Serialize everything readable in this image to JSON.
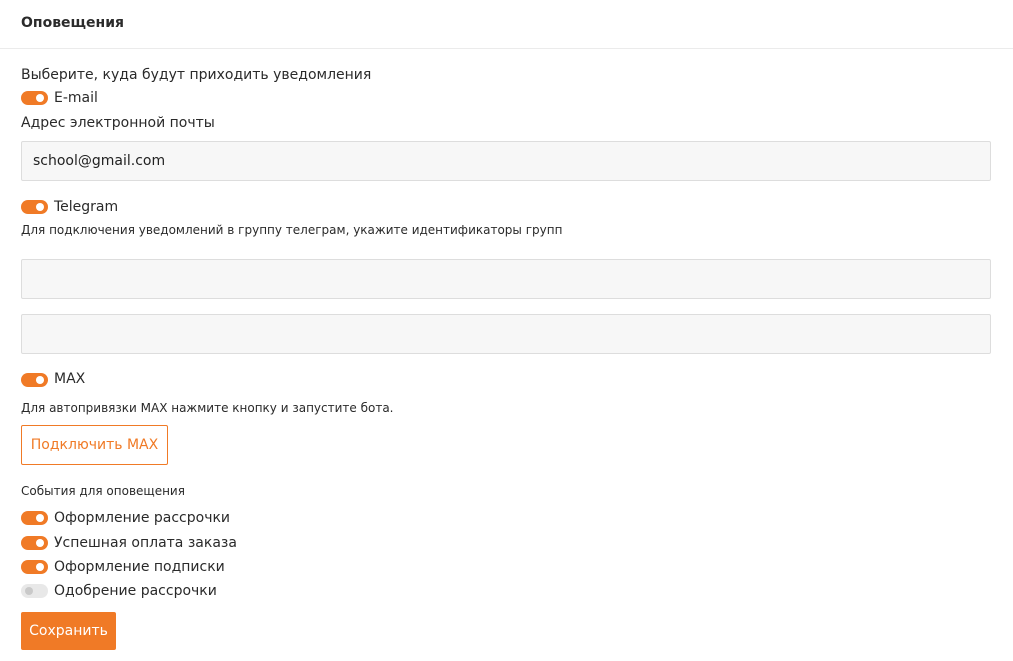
{
  "header": {
    "title": "Оповещения"
  },
  "intro": "Выберите, куда будут приходить уведомления",
  "email": {
    "toggle_label": "E-mail",
    "toggle_on": true,
    "field_label": "Адрес электронной почты",
    "value": "school@gmail.com"
  },
  "telegram": {
    "toggle_label": "Telegram",
    "toggle_on": true,
    "hint": "Для подключения уведомлений в группу телеграм, укажите идентификаторы групп",
    "group_ids": [
      "",
      ""
    ]
  },
  "max": {
    "toggle_label": "MAX",
    "toggle_on": true,
    "hint": "Для автопривязки MAX нажмите кнопку и запустите бота.",
    "connect_button": "Подключить MAX"
  },
  "events": {
    "title": "События для оповещения",
    "items": [
      {
        "label": "Оформление рассрочки",
        "on": true
      },
      {
        "label": "Успешная оплата заказа",
        "on": true
      },
      {
        "label": "Оформление подписки",
        "on": true
      },
      {
        "label": "Одобрение рассрочки",
        "on": false
      }
    ]
  },
  "save_button": "Сохранить",
  "colors": {
    "accent": "#f07a26",
    "field_bg": "#f7f7f7",
    "toggle_off": "#e8e8e8"
  }
}
